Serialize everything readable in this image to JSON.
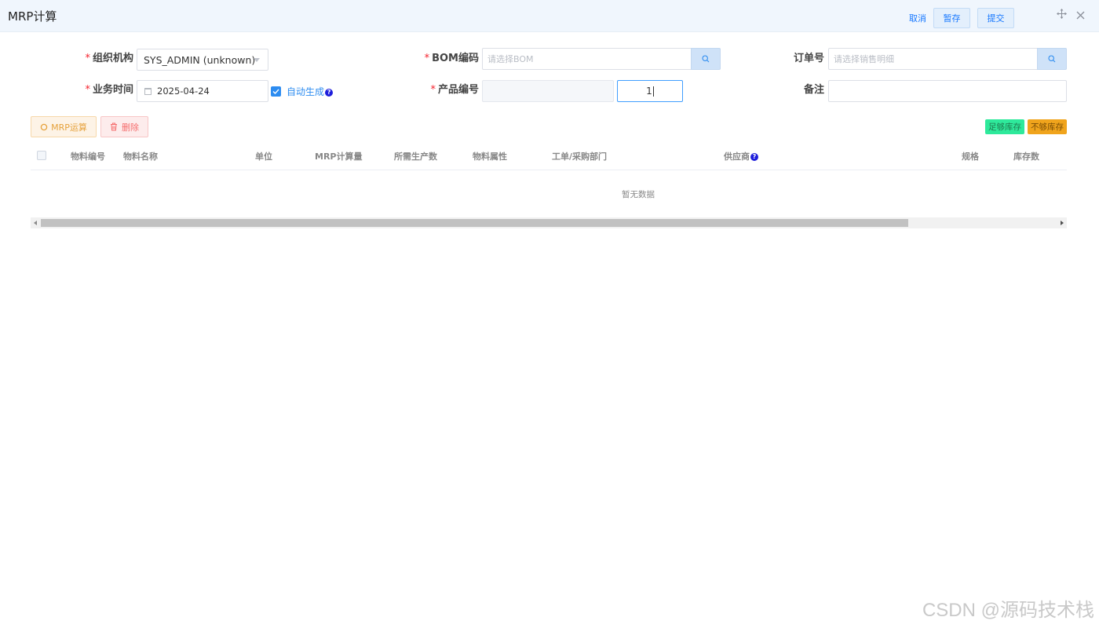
{
  "header": {
    "title": "MRP计算",
    "cancel_label": "取消",
    "save_label": "暂存",
    "submit_label": "提交"
  },
  "form": {
    "org": {
      "label": "组织机构",
      "value": "SYS_ADMIN (unknown)",
      "required": true
    },
    "bom": {
      "label": "BOM编码",
      "placeholder": "请选择BOM",
      "required": true
    },
    "order": {
      "label": "订单号",
      "placeholder": "请选择销售明细",
      "required": false
    },
    "biz_time": {
      "label": "业务时间",
      "value": "2025-04-24",
      "required": true
    },
    "auto_generate": {
      "label": "自动生成",
      "checked": true
    },
    "product_code": {
      "label": "产品编号",
      "value": "",
      "quantity": "1",
      "required": true
    },
    "remark": {
      "label": "备注",
      "value": ""
    }
  },
  "toolbar": {
    "mrp_label": "MRP运算",
    "delete_label": "删除",
    "tag_enough": "足够库存",
    "tag_short": "不够库存",
    "tag_enough_color": "#2ee99b",
    "tag_short_color": "#f0a41c"
  },
  "table": {
    "columns": [
      "物料编号",
      "物料名称",
      "单位",
      "MRP计算量",
      "所需生产数",
      "物料属性",
      "工单/采购部门",
      "供应商",
      "规格",
      "库存数"
    ],
    "rows": [],
    "empty_text": "暂无数据"
  },
  "watermark": "CSDN @源码技术栈"
}
